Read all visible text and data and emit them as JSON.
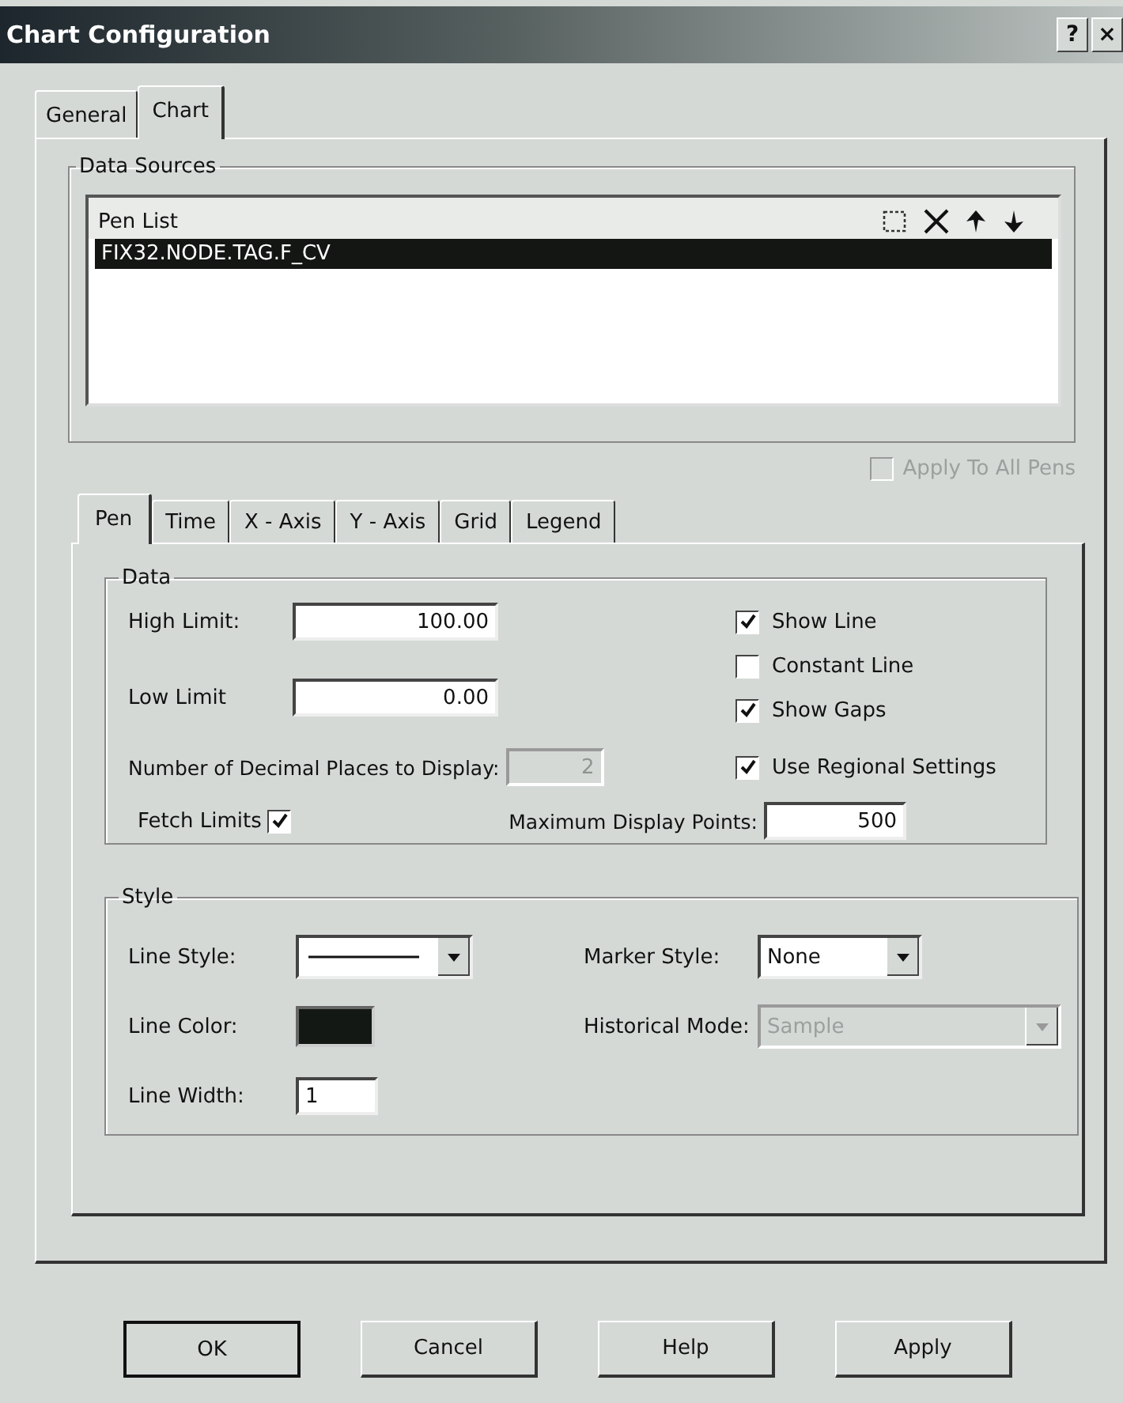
{
  "window": {
    "title": "Chart Configuration",
    "help_button": "?",
    "close_button": "×"
  },
  "tabs": [
    {
      "label": "General",
      "selected": false
    },
    {
      "label": "Chart",
      "selected": true
    }
  ],
  "data_sources": {
    "title": "Data Sources",
    "pen_list": {
      "label": "Pen List",
      "items": [
        {
          "text": "FIX32.NODE.TAG.F_CV",
          "selected": true
        }
      ]
    },
    "apply_to_all_pens": {
      "label": "Apply To All Pens",
      "checked": false,
      "disabled": true
    }
  },
  "pen_tabs": [
    {
      "label": "Pen",
      "selected": true
    },
    {
      "label": "Time",
      "selected": false
    },
    {
      "label": "X - Axis",
      "selected": false
    },
    {
      "label": "Y - Axis",
      "selected": false
    },
    {
      "label": "Grid",
      "selected": false
    },
    {
      "label": "Legend",
      "selected": false
    }
  ],
  "data": {
    "title": "Data",
    "fields": [
      {
        "label": "High Limit:",
        "value": "100.00"
      },
      {
        "label": "Low Limit",
        "value": "0.00"
      }
    ],
    "decimal_places": {
      "label": "Number of Decimal Places to Display:",
      "value": "2",
      "disabled": true
    },
    "checkboxes": [
      {
        "label": "Show Line",
        "checked": true
      },
      {
        "label": "Constant Line",
        "checked": false
      },
      {
        "label": "Show Gaps",
        "checked": true
      },
      {
        "label": "Use Regional Settings",
        "checked": true
      }
    ],
    "fetch_limits": {
      "label": "Fetch Limits",
      "checked": true
    },
    "max_points": {
      "label": "Maximum Display Points:",
      "value": "500"
    }
  },
  "style": {
    "title": "Style",
    "line_style": {
      "label": "Line Style:",
      "kind": "solid"
    },
    "line_color": {
      "label": "Line Color:",
      "color": "#141814"
    },
    "line_width": {
      "label": "Line Width:",
      "value": "1"
    },
    "marker_style": {
      "label": "Marker Style:",
      "value": "None",
      "disabled": false
    },
    "historical_mode": {
      "label": "Historical Mode:",
      "value": "Sample",
      "disabled": true
    }
  },
  "buttons": [
    {
      "label": "OK",
      "default": true
    },
    {
      "label": "Cancel",
      "default": false
    },
    {
      "label": "Help",
      "default": false
    },
    {
      "label": "Apply",
      "default": false
    }
  ]
}
